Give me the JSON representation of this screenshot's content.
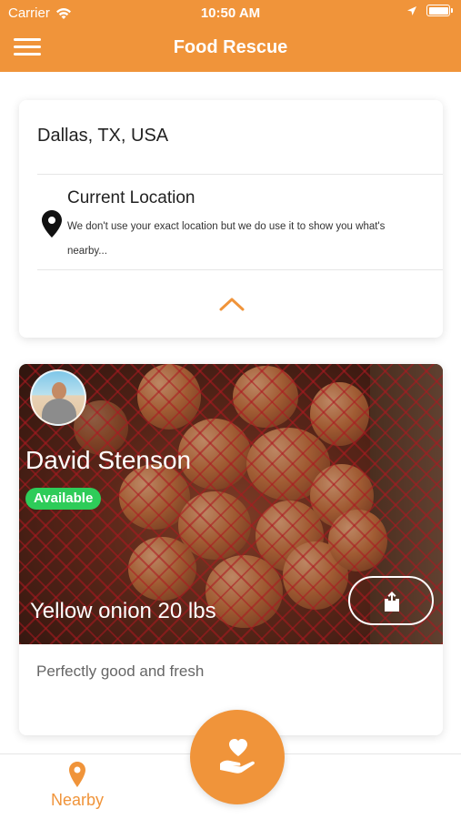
{
  "status_bar": {
    "carrier": "Carrier",
    "time": "10:50 AM"
  },
  "nav": {
    "title": "Food Rescue"
  },
  "location": {
    "value": "Dallas, TX, USA",
    "current_title": "Current Location",
    "current_description": "We don't use your exact location but we do use it to show you what's nearby..."
  },
  "listing": {
    "seller_name": "David Stenson",
    "status": "Available",
    "item_title": "Yellow onion 20 lbs",
    "description": "Perfectly good and fresh"
  },
  "tabs": {
    "nearby_label": "Nearby"
  },
  "colors": {
    "accent": "#f0943a",
    "available": "#2ecc59"
  }
}
